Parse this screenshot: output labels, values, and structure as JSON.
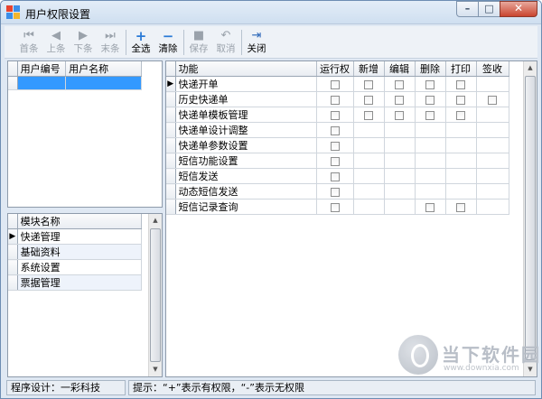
{
  "window": {
    "title": "用户权限设置"
  },
  "toolbar": {
    "first": "首条",
    "prev": "上条",
    "next": "下条",
    "last": "末条",
    "select_all": "全选",
    "clear": "清除",
    "save": "保存",
    "cancel": "取消",
    "close": "关闭"
  },
  "users_table": {
    "headers": [
      "用户编号",
      "用户名称"
    ],
    "rows": [
      [
        "",
        ""
      ]
    ]
  },
  "modules_table": {
    "header": "模块名称",
    "rows": [
      "快递管理",
      "基础资料",
      "系统设置",
      "票据管理"
    ]
  },
  "permissions_table": {
    "headers": [
      "功能",
      "运行权",
      "新增",
      "编辑",
      "删除",
      "打印",
      "签收"
    ],
    "rows": [
      {
        "name": "快递开单",
        "checks": [
          true,
          true,
          true,
          true,
          true,
          false
        ]
      },
      {
        "name": "历史快递单",
        "checks": [
          true,
          true,
          true,
          true,
          true,
          true
        ]
      },
      {
        "name": "快递单模板管理",
        "checks": [
          true,
          true,
          true,
          true,
          true,
          false
        ]
      },
      {
        "name": "快递单设计调整",
        "checks": [
          true,
          false,
          false,
          false,
          false,
          false
        ]
      },
      {
        "name": "快递单参数设置",
        "checks": [
          true,
          false,
          false,
          false,
          false,
          false
        ]
      },
      {
        "name": "短信功能设置",
        "checks": [
          true,
          false,
          false,
          false,
          false,
          false
        ]
      },
      {
        "name": "短信发送",
        "checks": [
          true,
          false,
          false,
          false,
          false,
          false
        ]
      },
      {
        "name": "动态短信发送",
        "checks": [
          true,
          false,
          false,
          false,
          false,
          false
        ]
      },
      {
        "name": "短信记录查询",
        "checks": [
          true,
          false,
          false,
          true,
          true,
          false
        ]
      }
    ]
  },
  "status": {
    "designer": "程序设计：一彩科技",
    "hint": "提示：“+”表示有权限，“-”表示无权限"
  },
  "watermark": {
    "name": "当下软件园",
    "url": "www.downxia.com"
  },
  "colors": {
    "selection": "#3399ff",
    "frame": "#dfe8f3"
  }
}
